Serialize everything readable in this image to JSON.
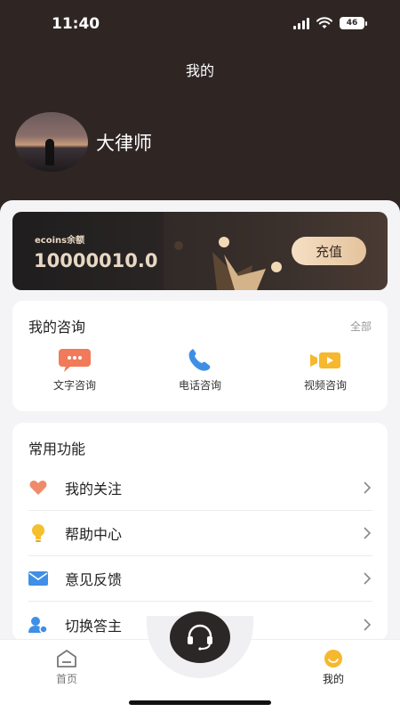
{
  "status_bar": {
    "time": "11:40",
    "battery": "46"
  },
  "header": {
    "title": "我的"
  },
  "profile": {
    "name": "大律师"
  },
  "wallet": {
    "label": "ecoins余额",
    "balance": "10000010.0",
    "recharge_label": "充值"
  },
  "consult": {
    "title": "我的咨询",
    "more": "全部",
    "items": [
      {
        "label": "文字咨询",
        "icon": "chat-bubble-icon"
      },
      {
        "label": "电话咨询",
        "icon": "phone-icon"
      },
      {
        "label": "视频咨询",
        "icon": "video-camera-icon"
      }
    ]
  },
  "functions": {
    "title": "常用功能",
    "items": [
      {
        "label": "我的关注",
        "icon": "heart-icon"
      },
      {
        "label": "帮助中心",
        "icon": "lightbulb-icon"
      },
      {
        "label": "意见反馈",
        "icon": "mail-icon"
      },
      {
        "label": "切换答主",
        "icon": "switch-user-icon"
      }
    ]
  },
  "tab_bar": {
    "items": [
      {
        "label": "首页",
        "icon": "home-icon"
      },
      {
        "label": "我的",
        "icon": "smile-icon"
      }
    ],
    "center_icon": "headset-icon"
  },
  "colors": {
    "header_bg": "#2f2624",
    "accent_orange": "#f5b82e",
    "active_tab": "#222222",
    "inactive_tab": "#777777"
  }
}
